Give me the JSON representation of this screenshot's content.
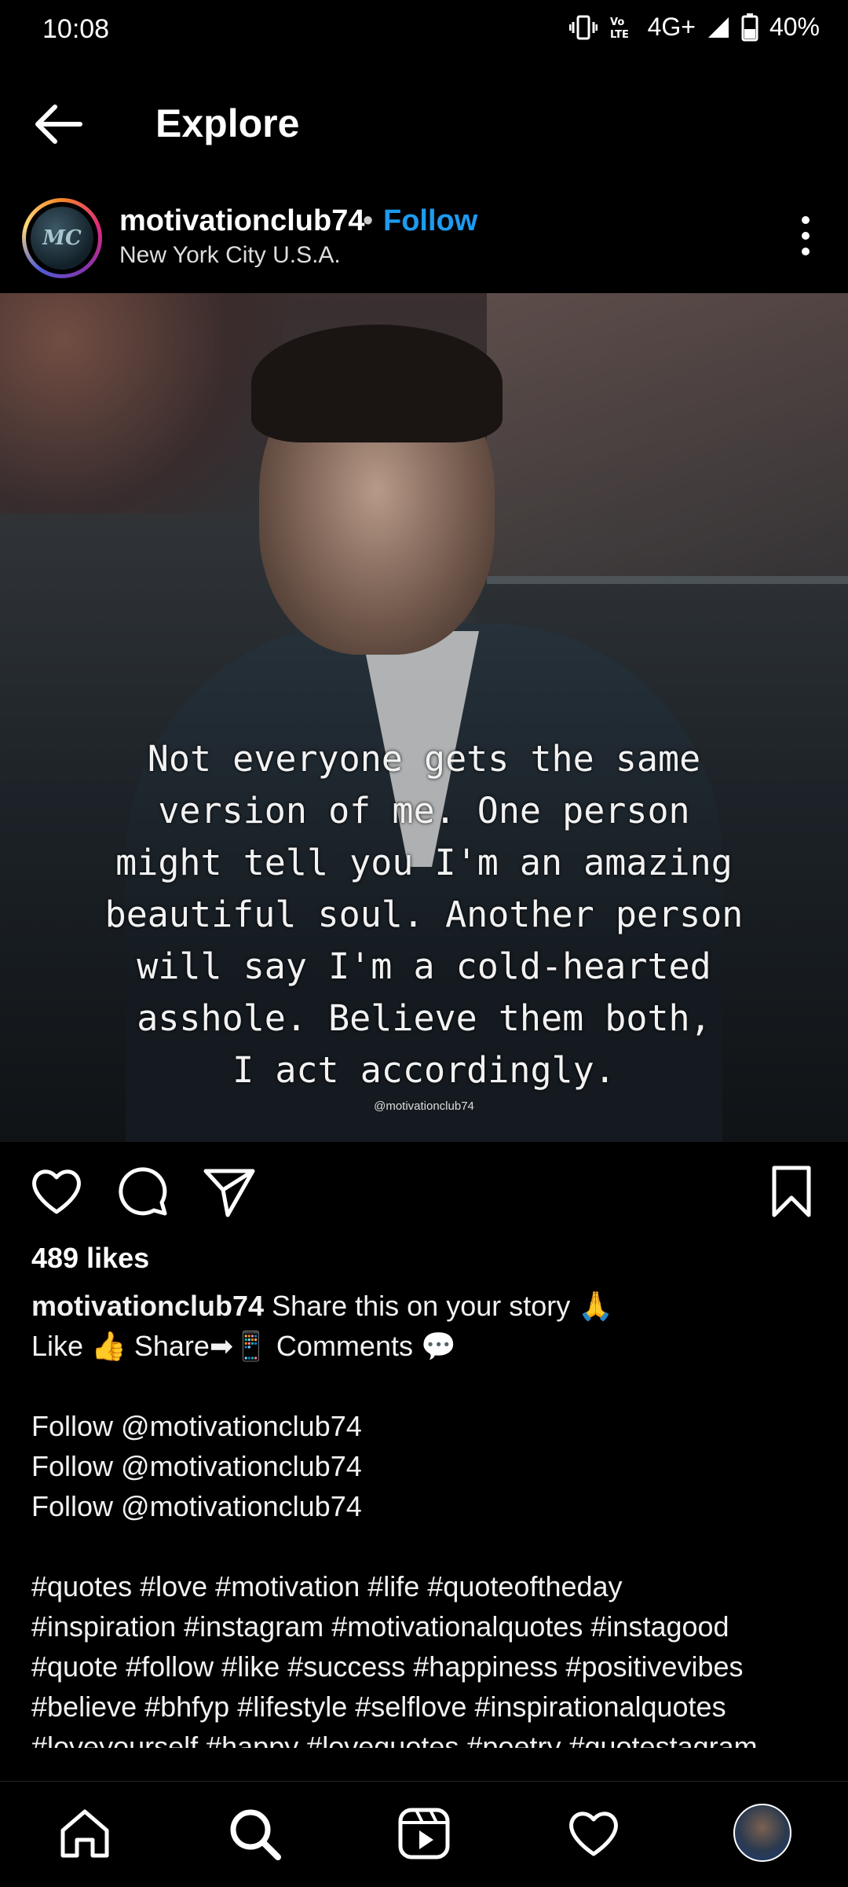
{
  "status_bar": {
    "time": "10:08",
    "network": "4G+",
    "battery": "40%",
    "icons": [
      "vibrate-icon",
      "volte-icon",
      "signal-icon",
      "battery-icon"
    ]
  },
  "header": {
    "title": "Explore",
    "back_icon": "arrow-left-icon"
  },
  "post": {
    "username": "motivationclub74",
    "separator": "•",
    "follow_label": "Follow",
    "location": "New York City U.S.A.",
    "avatar_initials": "MC",
    "image": {
      "quote": "Not everyone gets the same\nversion of me. One person\nmight tell you I'm an amazing\nbeautiful soul. Another person\nwill say I'm a cold-hearted\nasshole. Believe them both,\nI act accordingly.",
      "watermark": "@motivationclub74"
    },
    "likes": "489 likes",
    "caption": {
      "username": "motivationclub74",
      "line1": " Share this on your story 🙏",
      "line2": "Like 👍 Share➡📱 Comments 💬",
      "follow_lines": [
        "Follow @motivationclub74",
        "Follow @motivationclub74",
        "Follow @motivationclub74"
      ],
      "hashtag_lines": [
        "#quotes #love #motivation #life #quoteoftheday",
        "#inspiration #instagram #motivationalquotes #instagood",
        "#quote #follow #like #success #happiness #positivevibes",
        "#believe #bhfyp #lifestyle #selflove #inspirationalquotes",
        "#loveyourself #happy #lovequotes #poetry #quotestagram"
      ]
    }
  },
  "colors": {
    "background": "#000000",
    "follow_blue": "#1d9bf0"
  }
}
